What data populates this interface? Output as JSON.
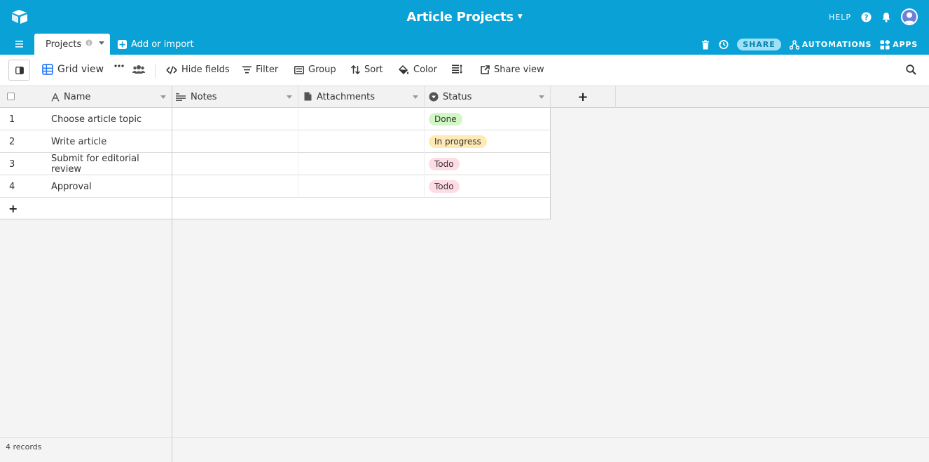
{
  "app": {
    "base_title": "Article Projects",
    "help_label": "HELP"
  },
  "tabs": {
    "active_tab": "Projects",
    "add_import_label": "Add or import",
    "share_label": "SHARE",
    "automations_label": "AUTOMATIONS",
    "apps_label": "APPS"
  },
  "toolbar": {
    "view_name": "Grid view",
    "hide_fields": "Hide fields",
    "filter": "Filter",
    "group": "Group",
    "sort": "Sort",
    "color": "Color",
    "share_view": "Share view"
  },
  "table": {
    "columns": [
      {
        "label": "Name",
        "icon": "text-field-icon"
      },
      {
        "label": "Notes",
        "icon": "long-text-icon"
      },
      {
        "label": "Attachments",
        "icon": "attachment-icon"
      },
      {
        "label": "Status",
        "icon": "single-select-icon"
      }
    ],
    "rows": [
      {
        "num": "1",
        "name": "Choose article topic",
        "status": "Done",
        "status_color": "#d1f7c4"
      },
      {
        "num": "2",
        "name": "Write article",
        "status": "In progress",
        "status_color": "#ffeab6"
      },
      {
        "num": "3",
        "name": "Submit for editorial review",
        "status": "Todo",
        "status_color": "#ffdce5"
      },
      {
        "num": "4",
        "name": "Approval",
        "status": "Todo",
        "status_color": "#ffdce5"
      }
    ],
    "add_row_symbol": "+",
    "add_column_symbol": "+"
  },
  "footer": {
    "record_count": "4 records"
  },
  "colors": {
    "brand": "#0aa2d6",
    "accent_blue": "#2d7ff9"
  }
}
